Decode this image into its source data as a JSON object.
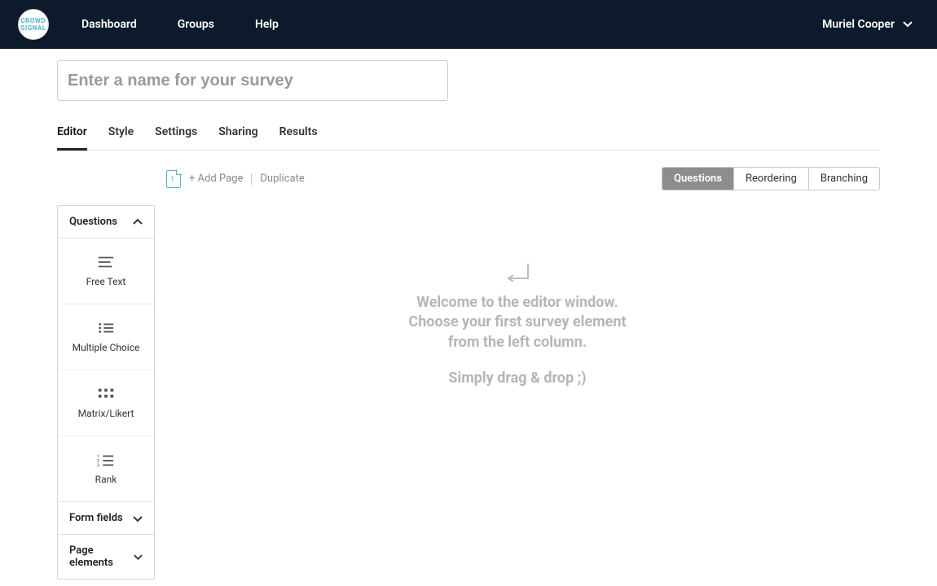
{
  "nav": {
    "links": [
      "Dashboard",
      "Groups",
      "Help"
    ],
    "user_name": "Muriel Cooper"
  },
  "survey_name_placeholder": "Enter a name for your survey",
  "tabs": [
    "Editor",
    "Style",
    "Settings",
    "Sharing",
    "Results"
  ],
  "active_tab": "Editor",
  "pages_tool": {
    "current_page": "1",
    "add_page": "+ Add Page",
    "duplicate": "Duplicate"
  },
  "view_toggle": [
    "Questions",
    "Reordering",
    "Branching"
  ],
  "active_view": "Questions",
  "sidebar": {
    "sections": {
      "questions": {
        "title": "Questions",
        "open": true,
        "items": [
          "Free Text",
          "Multiple Choice",
          "Matrix/Likert",
          "Rank"
        ]
      },
      "form_fields": {
        "title": "Form fields",
        "open": false
      },
      "page_elements": {
        "title": "Page elements",
        "open": false
      }
    }
  },
  "empty_state": {
    "line_a": "Welcome to the editor window.",
    "line_b": "Choose your first survey element",
    "line_c": "from the left column.",
    "line_d": "Simply drag & drop ;)"
  }
}
